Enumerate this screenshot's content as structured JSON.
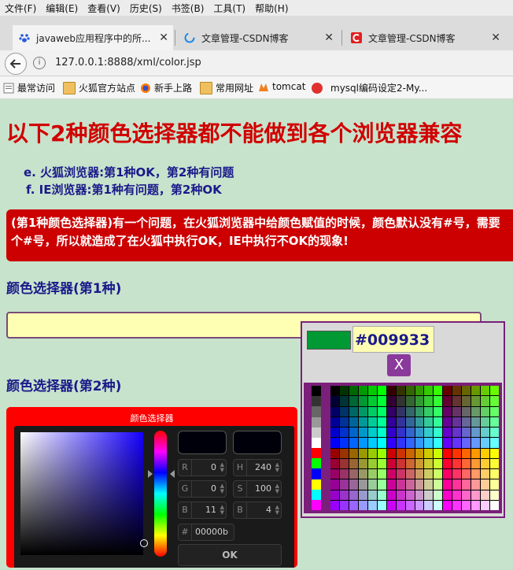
{
  "menu": [
    "文件(F)",
    "编辑(E)",
    "查看(V)",
    "历史(S)",
    "书签(B)",
    "工具(T)",
    "帮助(H)"
  ],
  "tabs": [
    {
      "title": "javaweb应用程序中的所...",
      "icon": "baidu-paw-icon",
      "icon_color": "#2a5bd7"
    },
    {
      "title": "文章管理-CSDN博客",
      "icon": "loading-icon",
      "icon_color": "#1e88e5"
    },
    {
      "title": "文章管理-CSDN博客",
      "icon": "csdn-icon",
      "icon_color": "#e02020"
    }
  ],
  "address": {
    "url": "127.0.0.1:8888/xml/color.jsp"
  },
  "bookmarks": [
    {
      "label": "最常访问",
      "icon": "bookmark-icon"
    },
    {
      "label": "火狐官方站点",
      "icon": "folder-icon"
    },
    {
      "label": "新手上路",
      "icon": "firefox-icon"
    },
    {
      "label": "常用网址",
      "icon": "folder-icon"
    },
    {
      "label": "tomcat",
      "icon": "tomcat-icon"
    },
    {
      "label": "mysql编码设定2-My...",
      "icon": "php-icon"
    }
  ],
  "page": {
    "heading": "以下2种颜色选择器都不能做到各个浏览器兼容",
    "list": [
      {
        "marker": "e.",
        "text": "火狐浏览器:第1种OK，第2种有问题"
      },
      {
        "marker": "f.",
        "text": "IE浏览器:第1种有问题，第2种OK"
      }
    ],
    "banner": {
      "line1": "(第1种颜色选择器)有一个问题，在火狐浏览器中给颜色赋值的时候，颜色默认没有#号，需要",
      "line2": "个#号，所以就造成了在火狐中执行OK，IE中执行不OK的现象!"
    },
    "section1": "颜色选择器(第1种)",
    "section2": "颜色选择器(第2种)"
  },
  "popup1": {
    "hex": "#009933",
    "preview_color": "#009933",
    "close_label": "X"
  },
  "picker2": {
    "title": "颜色选择器",
    "fields": [
      {
        "label": "R",
        "value": "0"
      },
      {
        "label": "H",
        "value": "240"
      },
      {
        "label": "G",
        "value": "0"
      },
      {
        "label": "S",
        "value": "100"
      },
      {
        "label": "B",
        "value": "11"
      },
      {
        "label": "B",
        "value": "4"
      }
    ],
    "hex_label": "#",
    "hex_value": "00000b",
    "ok_label": "OK"
  }
}
